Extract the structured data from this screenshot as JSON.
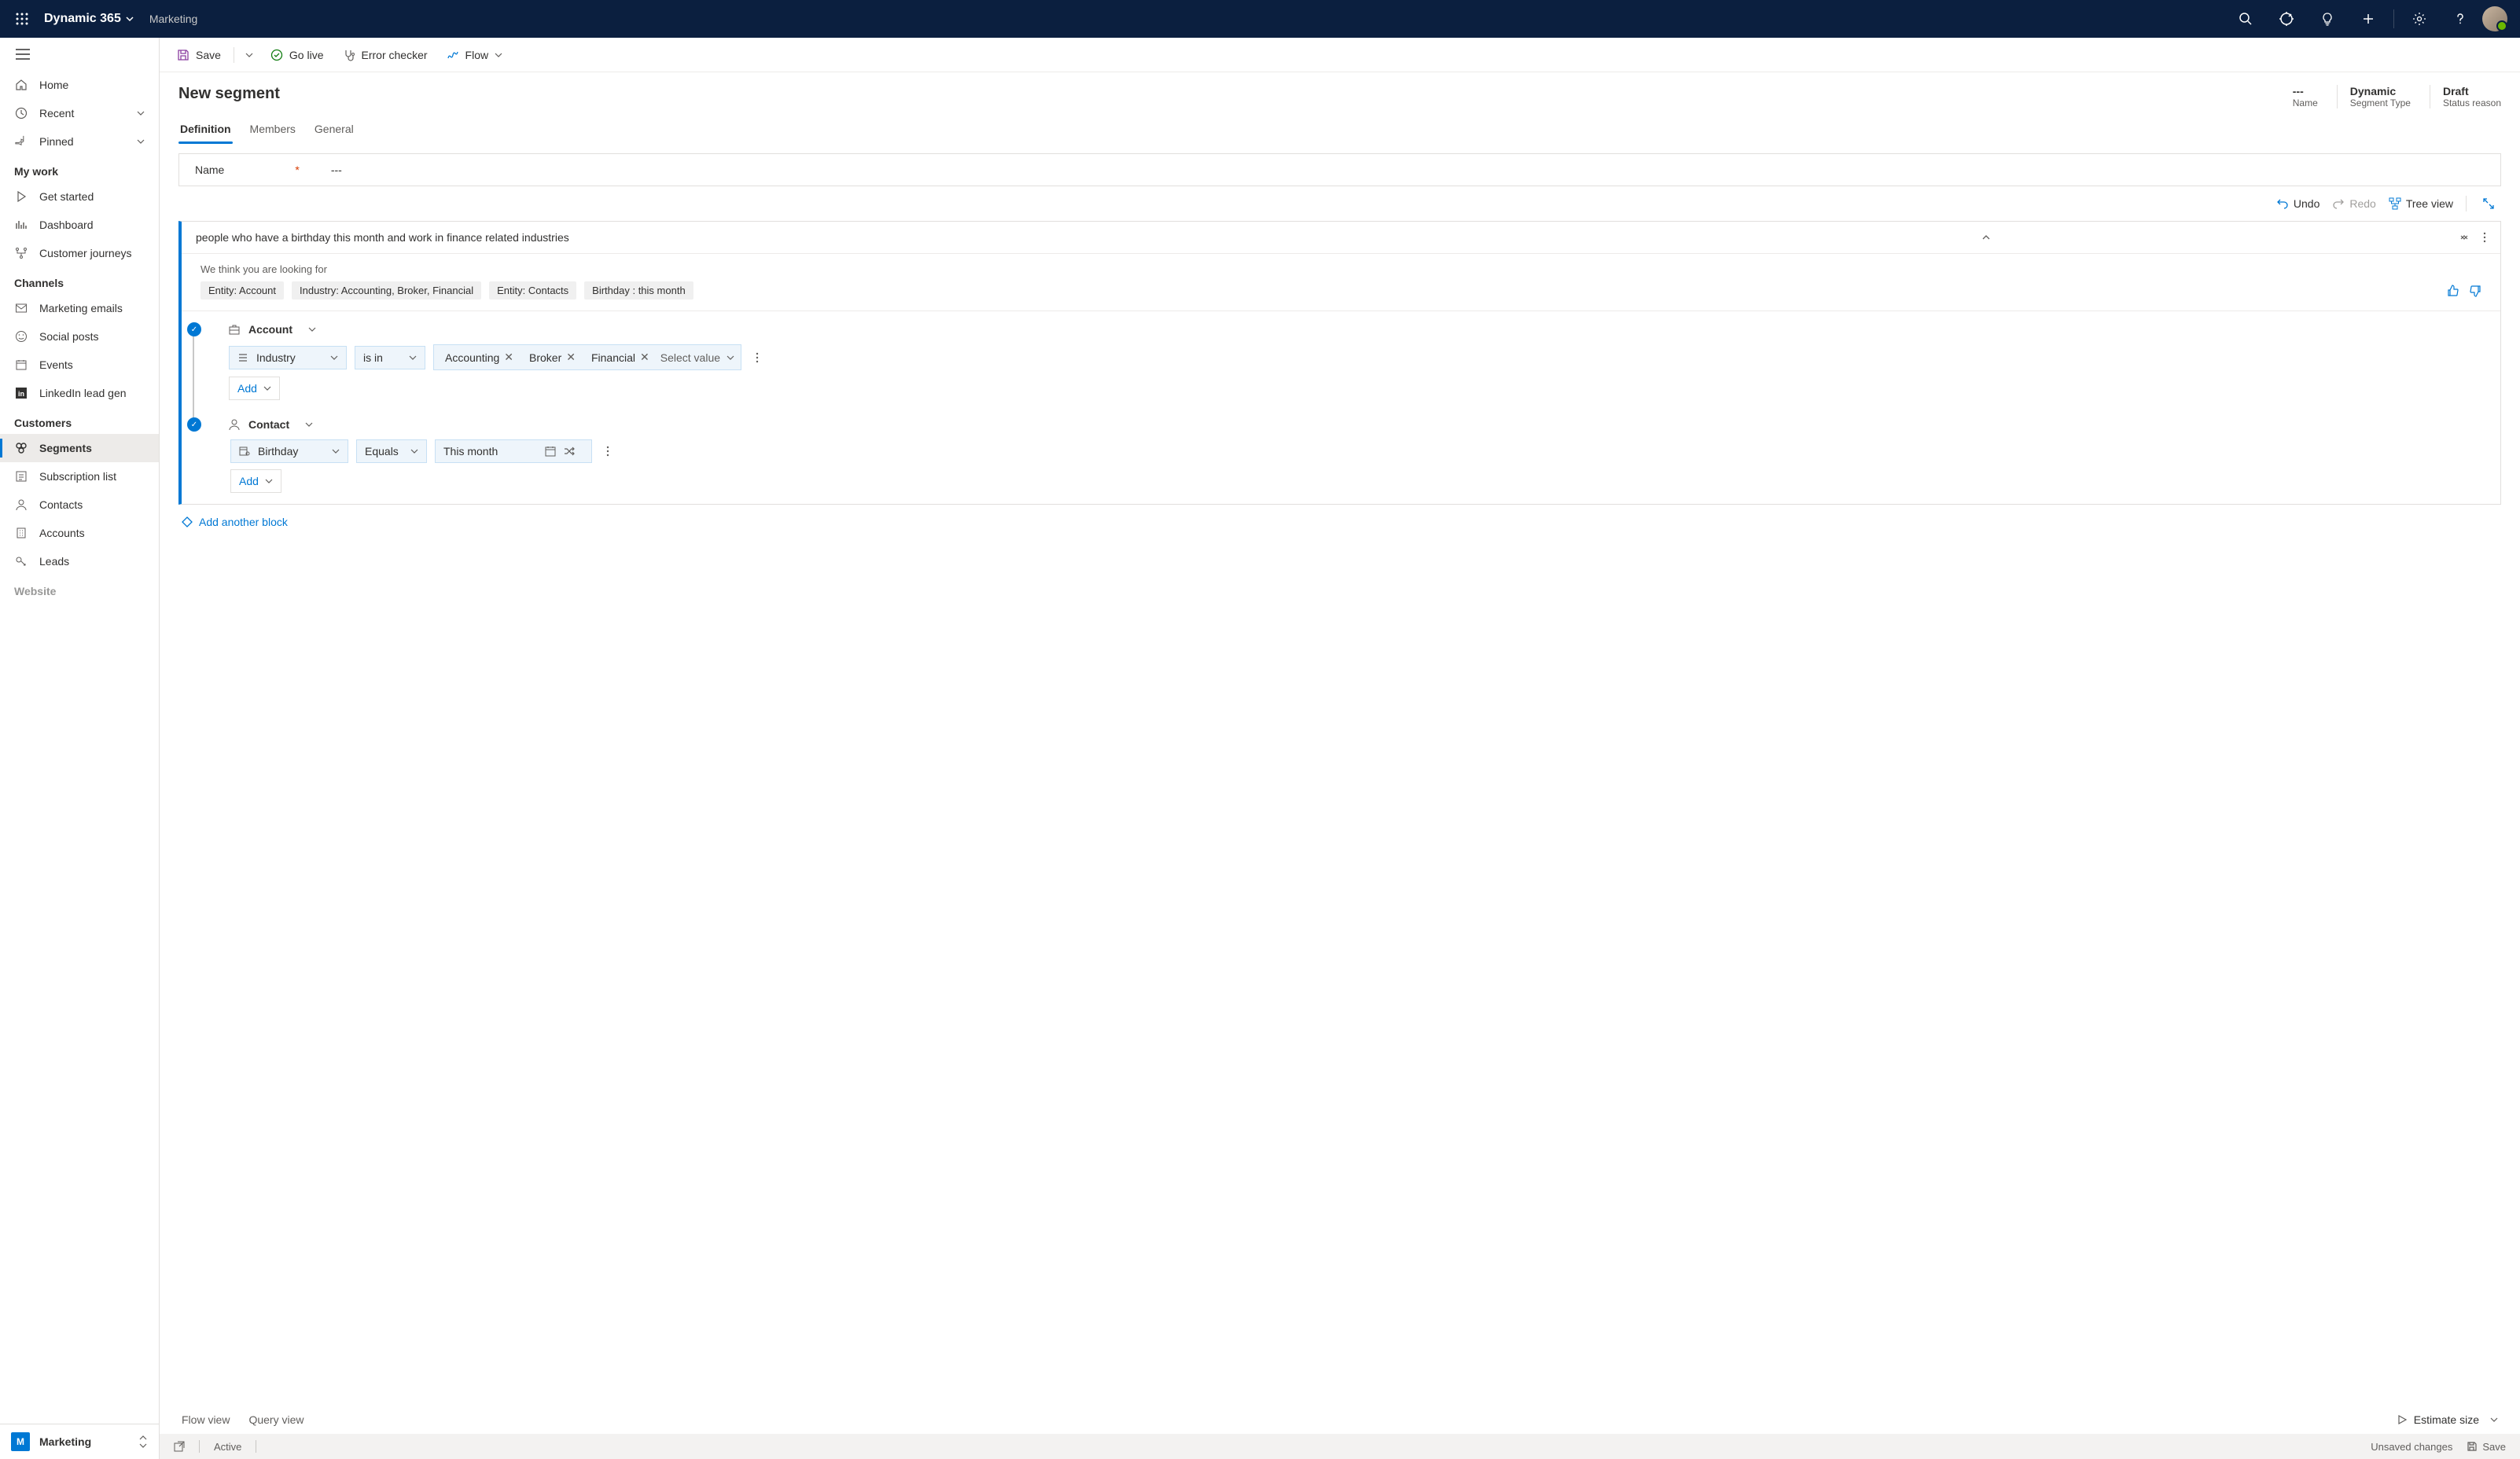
{
  "header": {
    "appName": "Dynamic 365",
    "subApp": "Marketing"
  },
  "sidebar": {
    "top": [
      {
        "label": "Home",
        "icon": "home"
      },
      {
        "label": "Recent",
        "icon": "clock",
        "expandable": true
      },
      {
        "label": "Pinned",
        "icon": "pin",
        "expandable": true
      }
    ],
    "sections": [
      {
        "title": "My work",
        "items": [
          {
            "label": "Get started",
            "icon": "play"
          },
          {
            "label": "Dashboard",
            "icon": "dashboard"
          },
          {
            "label": "Customer journeys",
            "icon": "journey"
          }
        ]
      },
      {
        "title": "Channels",
        "items": [
          {
            "label": "Marketing emails",
            "icon": "mail"
          },
          {
            "label": "Social posts",
            "icon": "smile"
          },
          {
            "label": "Events",
            "icon": "calendar"
          },
          {
            "label": "LinkedIn lead gen",
            "icon": "linkedin"
          }
        ]
      },
      {
        "title": "Customers",
        "items": [
          {
            "label": "Segments",
            "icon": "segments",
            "active": true
          },
          {
            "label": "Subscription list",
            "icon": "sublist"
          },
          {
            "label": "Contacts",
            "icon": "person"
          },
          {
            "label": "Accounts",
            "icon": "building"
          },
          {
            "label": "Leads",
            "icon": "leads"
          }
        ]
      }
    ],
    "truncatedSection": "Website",
    "appSwitcher": {
      "letter": "M",
      "label": "Marketing"
    }
  },
  "commandBar": {
    "save": "Save",
    "goLive": "Go live",
    "errorChecker": "Error checker",
    "flow": "Flow"
  },
  "page": {
    "title": "New segment",
    "meta": [
      {
        "value": "---",
        "label": "Name"
      },
      {
        "value": "Dynamic",
        "label": "Segment Type"
      },
      {
        "value": "Draft",
        "label": "Status reason"
      }
    ]
  },
  "tabs": [
    "Definition",
    "Members",
    "General"
  ],
  "nameField": {
    "label": "Name",
    "value": "---"
  },
  "canvasToolbar": {
    "undo": "Undo",
    "redo": "Redo",
    "treeView": "Tree view"
  },
  "query": {
    "nlText": "people who have a birthday this month and work in finance related industries",
    "suggestionLabel": "We think you are looking for",
    "chips": [
      "Entity: Account",
      "Industry:  Accounting, Broker, Financial",
      "Entity: Contacts",
      "Birthday : this month"
    ],
    "groups": [
      {
        "entity": "Account",
        "icon": "briefcase",
        "conditions": [
          {
            "field": "Industry",
            "fieldIcon": "list",
            "operator": "is in",
            "values": [
              "Accounting",
              "Broker",
              "Financial"
            ],
            "placeholder": "Select value"
          }
        ],
        "addLabel": "Add"
      },
      {
        "entity": "Contact",
        "icon": "person",
        "conditions": [
          {
            "field": "Birthday",
            "fieldIcon": "calendar-person",
            "operator": "Equals",
            "dateValue": "This month"
          }
        ],
        "addLabel": "Add"
      }
    ],
    "addBlock": "Add another block"
  },
  "viewTabs": {
    "flowView": "Flow view",
    "queryView": "Query view",
    "estimate": "Estimate size"
  },
  "statusBar": {
    "active": "Active",
    "unsaved": "Unsaved changes",
    "save": "Save"
  }
}
